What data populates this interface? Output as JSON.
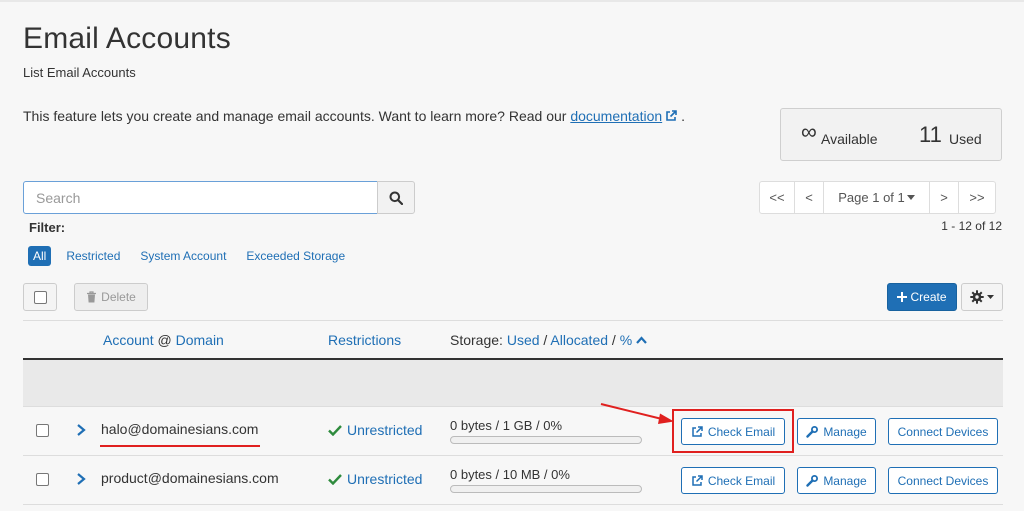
{
  "header": {
    "title": "Email Accounts",
    "subtitle": "List Email Accounts",
    "intro_text": "This feature lets you create and manage email accounts. Want to learn more? Read our ",
    "intro_link": "documentation",
    "intro_end": "."
  },
  "stats": {
    "available_symbol": "∞",
    "available_label": "Available",
    "used_count": "11",
    "used_label": "Used"
  },
  "search": {
    "placeholder": "Search"
  },
  "pagination": {
    "first": "<<",
    "prev": "<",
    "page_label": "Page 1 of 1",
    "next": ">",
    "last": ">>",
    "range": "1 - 12 of 12"
  },
  "filter": {
    "label": "Filter:",
    "options": [
      "All",
      "Restricted",
      "System Account",
      "Exceeded Storage"
    ],
    "active": "All"
  },
  "toolbar": {
    "delete_label": "Delete",
    "create_label": "Create"
  },
  "table": {
    "headers": {
      "account": "Account",
      "at": "@",
      "domain": "Domain",
      "restrictions": "Restrictions",
      "storage_prefix": "Storage:",
      "used": "Used",
      "sep": "/",
      "allocated": "Allocated",
      "percent": "%"
    },
    "rows": [
      {
        "email": "halo@domainesians.com",
        "restriction": "Unrestricted",
        "storage": "0 bytes / 1 GB / 0%",
        "usage_percent": 0,
        "check_email": "Check Email",
        "manage": "Manage",
        "connect": "Connect Devices"
      },
      {
        "email": "product@domainesians.com",
        "restriction": "Unrestricted",
        "storage": "0 bytes / 10 MB / 0%",
        "usage_percent": 0,
        "check_email": "Check Email",
        "manage": "Manage",
        "connect": "Connect Devices"
      }
    ]
  },
  "colors": {
    "accent": "#1f6fb5",
    "annotation": "#e0201f",
    "success": "#2e8b3d"
  }
}
